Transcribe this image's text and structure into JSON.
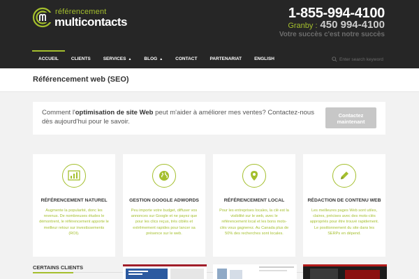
{
  "brand": {
    "logo_top": "référencement",
    "logo_bottom": "multicontacts",
    "accent": "#a4bf2d"
  },
  "contact": {
    "phone": "1-855-994-4100",
    "granby_label": "Granby :",
    "granby_number": "450 994-4100",
    "tagline": "Votre succès c'est notre succès"
  },
  "nav": {
    "items": [
      {
        "label": "ACCUEIL",
        "active": true
      },
      {
        "label": "CLIENTS"
      },
      {
        "label": "SERVICES",
        "caret": "▲"
      },
      {
        "label": "BLOG",
        "caret": "▲"
      },
      {
        "label": "CONTACT"
      },
      {
        "label": "PARTENARIAT"
      },
      {
        "label": "ENGLISH"
      }
    ],
    "search_placeholder": "Enter search keyword"
  },
  "page": {
    "title": "Référencement web (SEO)"
  },
  "cta": {
    "text_before": "Comment l'",
    "text_bold": "optimisation de site Web",
    "text_after": " peut m'aider à améliorer mes ventes? Contactez-nous dès aujourd'hui pour le savoir.",
    "button": "Contactez maintenant"
  },
  "services": [
    {
      "icon": "bar-chart-icon",
      "title": "RÉFÉRENCEMENT NATUREL",
      "text": "Augmente la popularité, donc les revenus. De nombreuses études le démontrent, le référencement apporte le meilleur retour sur investissements (ROI)."
    },
    {
      "icon": "globe-icon",
      "title": "GESTION GOOGLE ADWORDS",
      "text": "Peu importe votre budget, diffuser vos annonces sur Google et ne payez que pour les clics reçus, très ciblés et extrêmement rapides pour lancer sa présence sur le web."
    },
    {
      "icon": "location-icon",
      "title": "RÉFÉRENCEMENT LOCAL",
      "text": "Pour les entreprises locales, la clé est la visibilité sur le web, avec le référencement local et les bons mots-clés vous gagnerez. Au Canada plus de 50% des recherches sont locales."
    },
    {
      "icon": "pencil-icon",
      "title": "RÉDACTION DE CONTENU WEB",
      "text": "Les meilleures pages Web sont utiles, claires, précises avec des mots-clés appropriés pour être trouvé rapidement. Le positionnement du site dans les SERPs en dépend."
    }
  ],
  "clients": {
    "title": "CERTAINS CLIENTS"
  }
}
